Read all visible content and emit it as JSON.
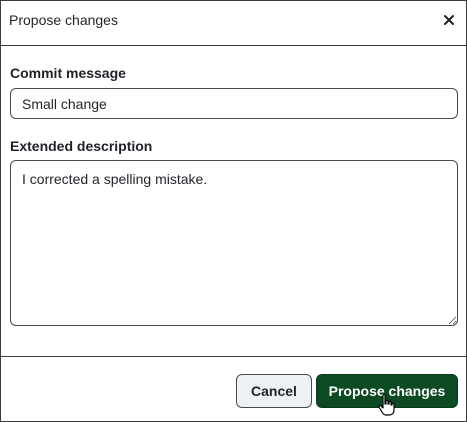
{
  "dialog": {
    "title": "Propose changes",
    "close_icon": "close-icon"
  },
  "form": {
    "commit_label": "Commit message",
    "commit_value": "Small change",
    "description_label": "Extended description",
    "description_value": "I corrected a spelling mistake."
  },
  "footer": {
    "cancel_label": "Cancel",
    "propose_label": "Propose changes"
  },
  "colors": {
    "primary_button": "#0b4a22",
    "secondary_button": "#eef1f4",
    "border": "#3b3b3b"
  },
  "cursor_icon": "hand-pointer-icon"
}
